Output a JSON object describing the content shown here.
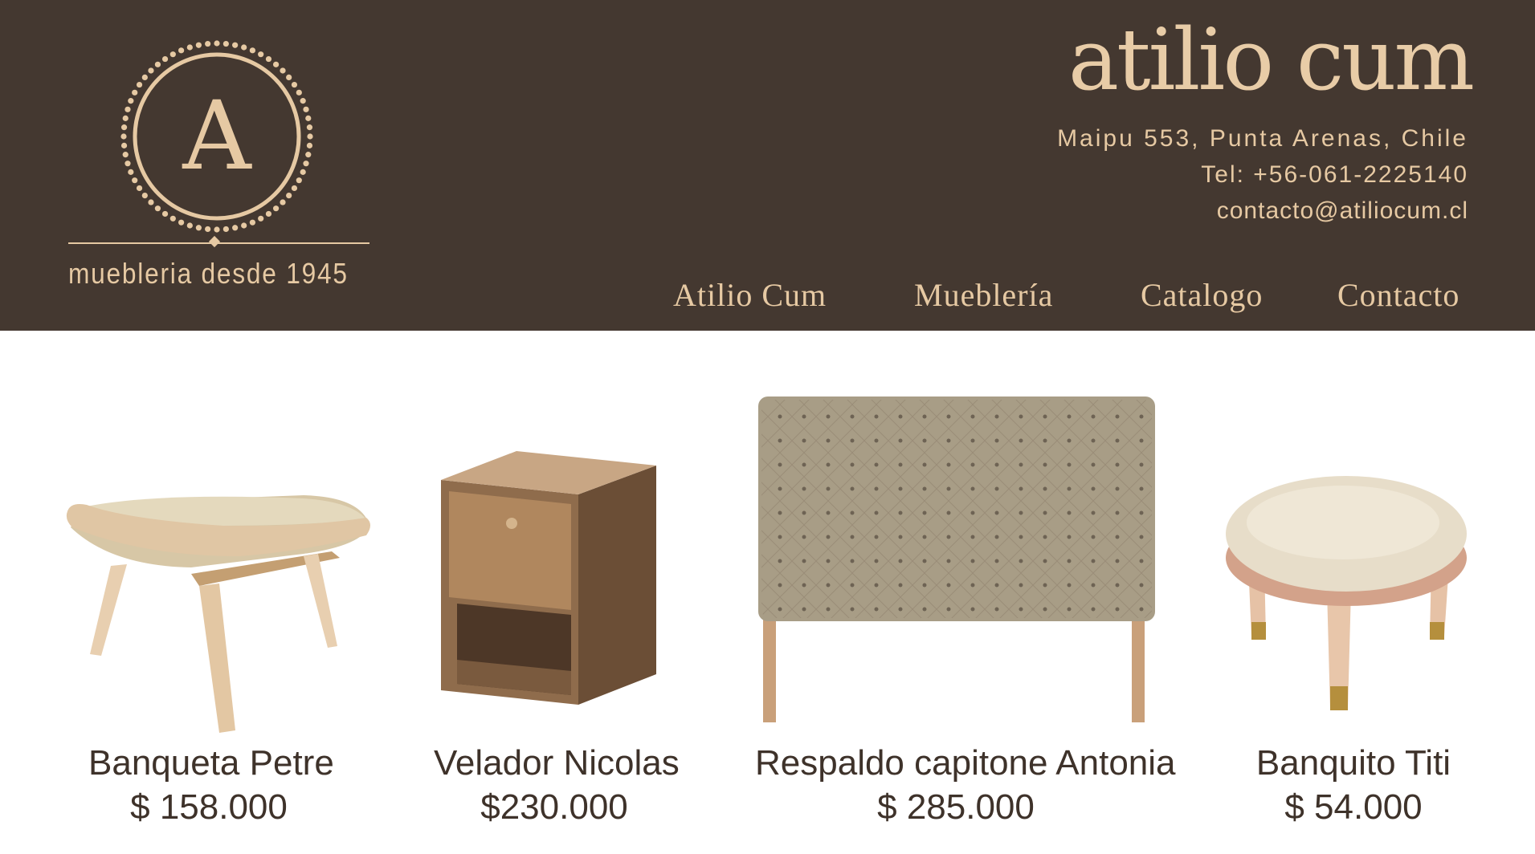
{
  "header": {
    "brand": "atilio cum",
    "logo_monogram": "A",
    "tagline": "muebleria desde 1945",
    "address": "Maipu 553, Punta Arenas, Chile",
    "phone": "Tel: +56-061-2225140",
    "email": "contacto@atiliocum.cl",
    "colors": {
      "background": "#443830",
      "accent": "#e6c9a3"
    }
  },
  "nav": [
    {
      "label": "Atilio Cum"
    },
    {
      "label": "Mueblería"
    },
    {
      "label": "Catalogo"
    },
    {
      "label": "Contacto"
    }
  ],
  "products": [
    {
      "name": "Banqueta  Petre",
      "price": "$ 158.000"
    },
    {
      "name": "Velador Nicolas",
      "price": "$230.000"
    },
    {
      "name": "Respaldo capitone Antonia",
      "price": "$ 285.000"
    },
    {
      "name": "Banquito Titi",
      "price": "$ 54.000"
    }
  ]
}
